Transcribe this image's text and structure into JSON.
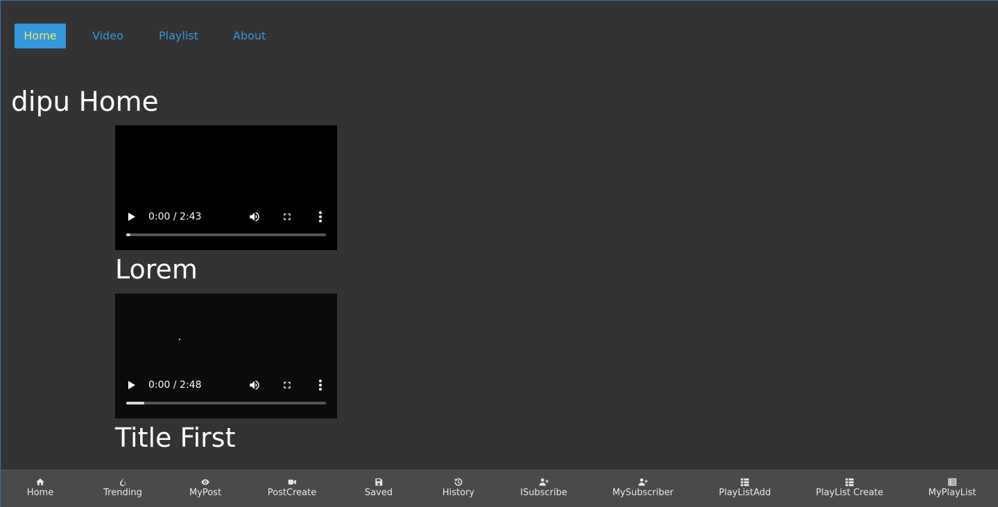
{
  "nav": {
    "items": [
      {
        "label": "Home",
        "active": true
      },
      {
        "label": "Video"
      },
      {
        "label": "Playlist"
      },
      {
        "label": "About"
      }
    ]
  },
  "page": {
    "title": "dipu Home"
  },
  "videos": [
    {
      "time": "0:00 / 2:43",
      "progress": 0.02,
      "title": "Lorem"
    },
    {
      "time": "0:00 / 2:48",
      "progress": 0.09,
      "title": "Title First"
    }
  ],
  "bottom_nav": {
    "items": [
      {
        "label": "Home",
        "icon": "home-icon"
      },
      {
        "label": "Trending",
        "icon": "fire-icon"
      },
      {
        "label": "MyPost",
        "icon": "eye-icon"
      },
      {
        "label": "PostCreate",
        "icon": "video-camera-icon"
      },
      {
        "label": "Saved",
        "icon": "save-icon"
      },
      {
        "label": "History",
        "icon": "history-icon"
      },
      {
        "label": "ISubscribe",
        "icon": "user-plus-icon"
      },
      {
        "label": "MySubscriber",
        "icon": "user-plus-icon"
      },
      {
        "label": "PlayListAdd",
        "icon": "list-icon"
      },
      {
        "label": "PlayList Create",
        "icon": "list-icon"
      },
      {
        "label": "MyPlayList",
        "icon": "list-alt-icon"
      }
    ]
  },
  "colors": {
    "background": "#333333",
    "accent": "#3498db",
    "active_text": "#f1e36b",
    "bottom_bar": "#4a4a4a"
  }
}
